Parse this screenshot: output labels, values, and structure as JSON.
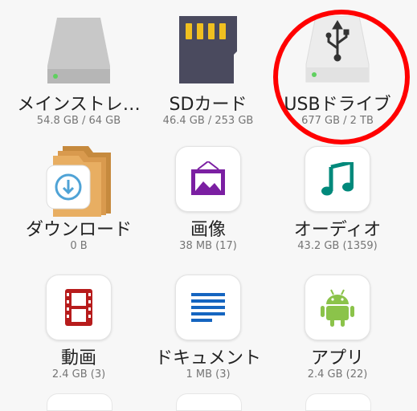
{
  "storage": {
    "internal": {
      "label": "メインストレ…",
      "usage": "54.8 GB / 64 GB"
    },
    "sdcard": {
      "label": "SDカード",
      "usage": "46.4 GB / 253 GB"
    },
    "usb": {
      "label": "USBドライブ",
      "usage": "677 GB / 2 TB"
    }
  },
  "categories": {
    "download": {
      "label": "ダウンロード",
      "usage": "0 B"
    },
    "images": {
      "label": "画像",
      "usage": "38 MB (17)"
    },
    "audio": {
      "label": "オーディオ",
      "usage": "43.2 GB (1359)"
    },
    "video": {
      "label": "動画",
      "usage": "2.4 GB (3)"
    },
    "documents": {
      "label": "ドキュメント",
      "usage": "1 MB (3)"
    },
    "apps": {
      "label": "アプリ",
      "usage": "2.4 GB (22)"
    }
  },
  "colors": {
    "highlight": "#ff0000",
    "image_icon": "#7b1fa2",
    "audio_icon": "#00897b",
    "video_icon": "#b71c1c",
    "document_icon": "#1565c0",
    "app_icon": "#8bc34a",
    "folder": "#e0a85a"
  }
}
